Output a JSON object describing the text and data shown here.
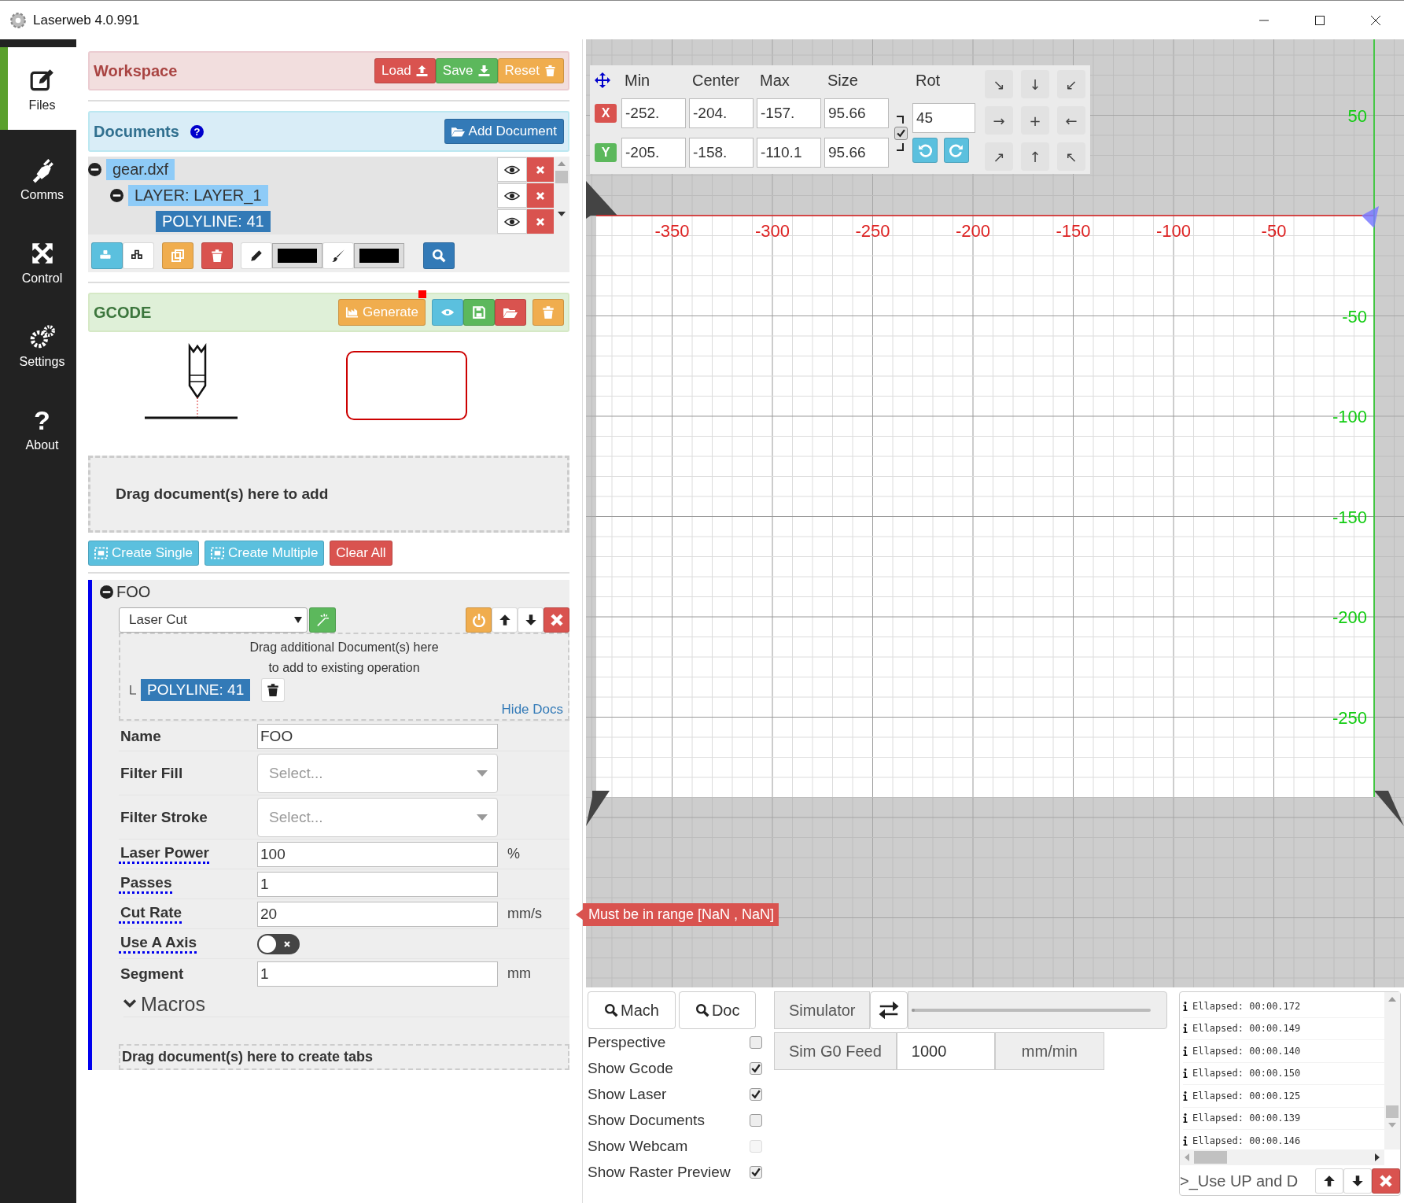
{
  "window": {
    "title": "Laserweb 4.0.991"
  },
  "nav": [
    {
      "label": "Files",
      "kind": "files",
      "selected": true
    },
    {
      "label": "Comms",
      "kind": "comms",
      "selected": false
    },
    {
      "label": "Control",
      "kind": "control",
      "selected": false
    },
    {
      "label": "Settings",
      "kind": "settings",
      "selected": false
    },
    {
      "label": "About",
      "kind": "about",
      "glyph": "?",
      "selected": false
    }
  ],
  "workspace": {
    "title": "Workspace",
    "buttons": [
      {
        "label": "Load",
        "kind": "load"
      },
      {
        "label": "Save",
        "kind": "save"
      },
      {
        "label": "Reset",
        "kind": "reset"
      }
    ]
  },
  "documents": {
    "title": "Documents",
    "help_glyph": "?",
    "add_button": "Add Document",
    "tree": [
      {
        "label": "gear.dxf",
        "selected": false,
        "expanded": true,
        "children": [
          {
            "label": "LAYER: LAYER_1",
            "selected": false,
            "expanded": true,
            "children": [
              {
                "label": "POLYLINE: 41",
                "selected": true
              }
            ]
          }
        ]
      }
    ]
  },
  "gcode": {
    "title": "GCODE",
    "generate": "Generate",
    "modified": true
  },
  "drop_zone": "Drag document(s) here to add",
  "operation_buttons": [
    {
      "label": "Create Single",
      "kind": "info"
    },
    {
      "label": "Create Multiple",
      "kind": "info"
    },
    {
      "label": "Clear All",
      "kind": "danger"
    }
  ],
  "operation": {
    "title": "FOO",
    "expanded": true,
    "type": "Laser Cut",
    "docs_hint": [
      "Drag additional Document(s) here",
      "to add to existing operation"
    ],
    "docs": [
      "POLYLINE: 41"
    ],
    "hide_docs": "Hide Docs",
    "fields": [
      {
        "label": "Name",
        "kind": "text",
        "value": "FOO",
        "help": false
      },
      {
        "label": "Filter Fill",
        "kind": "select",
        "placeholder": "Select...",
        "help": false
      },
      {
        "label": "Filter Stroke",
        "kind": "select",
        "placeholder": "Select...",
        "help": false
      },
      {
        "label": "Laser Power",
        "kind": "text",
        "value": "100",
        "unit": "%",
        "help": true
      },
      {
        "label": "Passes",
        "kind": "text",
        "value": "1",
        "help": true
      },
      {
        "label": "Cut Rate",
        "kind": "text",
        "value": "20",
        "unit": "mm/s",
        "help": true
      },
      {
        "label": "Use A Axis",
        "kind": "toggle",
        "on": false,
        "help": true
      },
      {
        "label": "Segment",
        "kind": "text",
        "value": "1",
        "unit": "mm",
        "help": false
      }
    ],
    "macros": "Macros",
    "tabs_drop": "Drag document(s) here to create tabs"
  },
  "tooltip": "Must be in range [NaN , NaN]",
  "transform": {
    "headers": [
      "Min",
      "Center",
      "Max",
      "Size"
    ],
    "rot_label": "Rot",
    "rot": "45",
    "lock_aspect": true,
    "rows": [
      {
        "axis": "X",
        "kind": "x",
        "values": [
          "-252.",
          "-204.",
          "-157.",
          "95.66"
        ]
      },
      {
        "axis": "Y",
        "kind": "y",
        "values": [
          "-205.",
          "-158.",
          "-110.1",
          "95.66"
        ]
      }
    ],
    "jog": [
      "↘",
      "↓",
      "↙",
      "→",
      "+",
      "←",
      "↗",
      "↑",
      "↖"
    ]
  },
  "canvas": {
    "x_labels": [
      "-350",
      "-300",
      "-250",
      "-200",
      "-150",
      "-100",
      "-50"
    ],
    "y_labels": [
      "50",
      "-50",
      "-100",
      "-150",
      "-200",
      "-250"
    ]
  },
  "view": {
    "buttons": [
      "Mach",
      "Doc"
    ],
    "options": [
      {
        "label": "Perspective",
        "checked": false,
        "disabled": false
      },
      {
        "label": "Show Gcode",
        "checked": true,
        "disabled": false
      },
      {
        "label": "Show Laser",
        "checked": true,
        "disabled": false
      },
      {
        "label": "Show Documents",
        "checked": false,
        "disabled": false
      },
      {
        "label": "Show Webcam",
        "checked": false,
        "disabled": true
      },
      {
        "label": "Show Raster Preview",
        "checked": true,
        "disabled": false
      }
    ]
  },
  "simulator": {
    "label": "Simulator",
    "level": 0,
    "feed_label": "Sim G0 Feed",
    "feed": "1000",
    "feed_unit": "mm/min"
  },
  "console": {
    "lines": [
      "Ellapsed: 00:00.172",
      "Ellapsed: 00:00.149",
      "Ellapsed: 00:00.140",
      "Ellapsed: 00:00.150",
      "Ellapsed: 00:00.125",
      "Ellapsed: 00:00.139",
      "Ellapsed: 00:00.146"
    ],
    "placeholder": ">_Use UP and D"
  }
}
